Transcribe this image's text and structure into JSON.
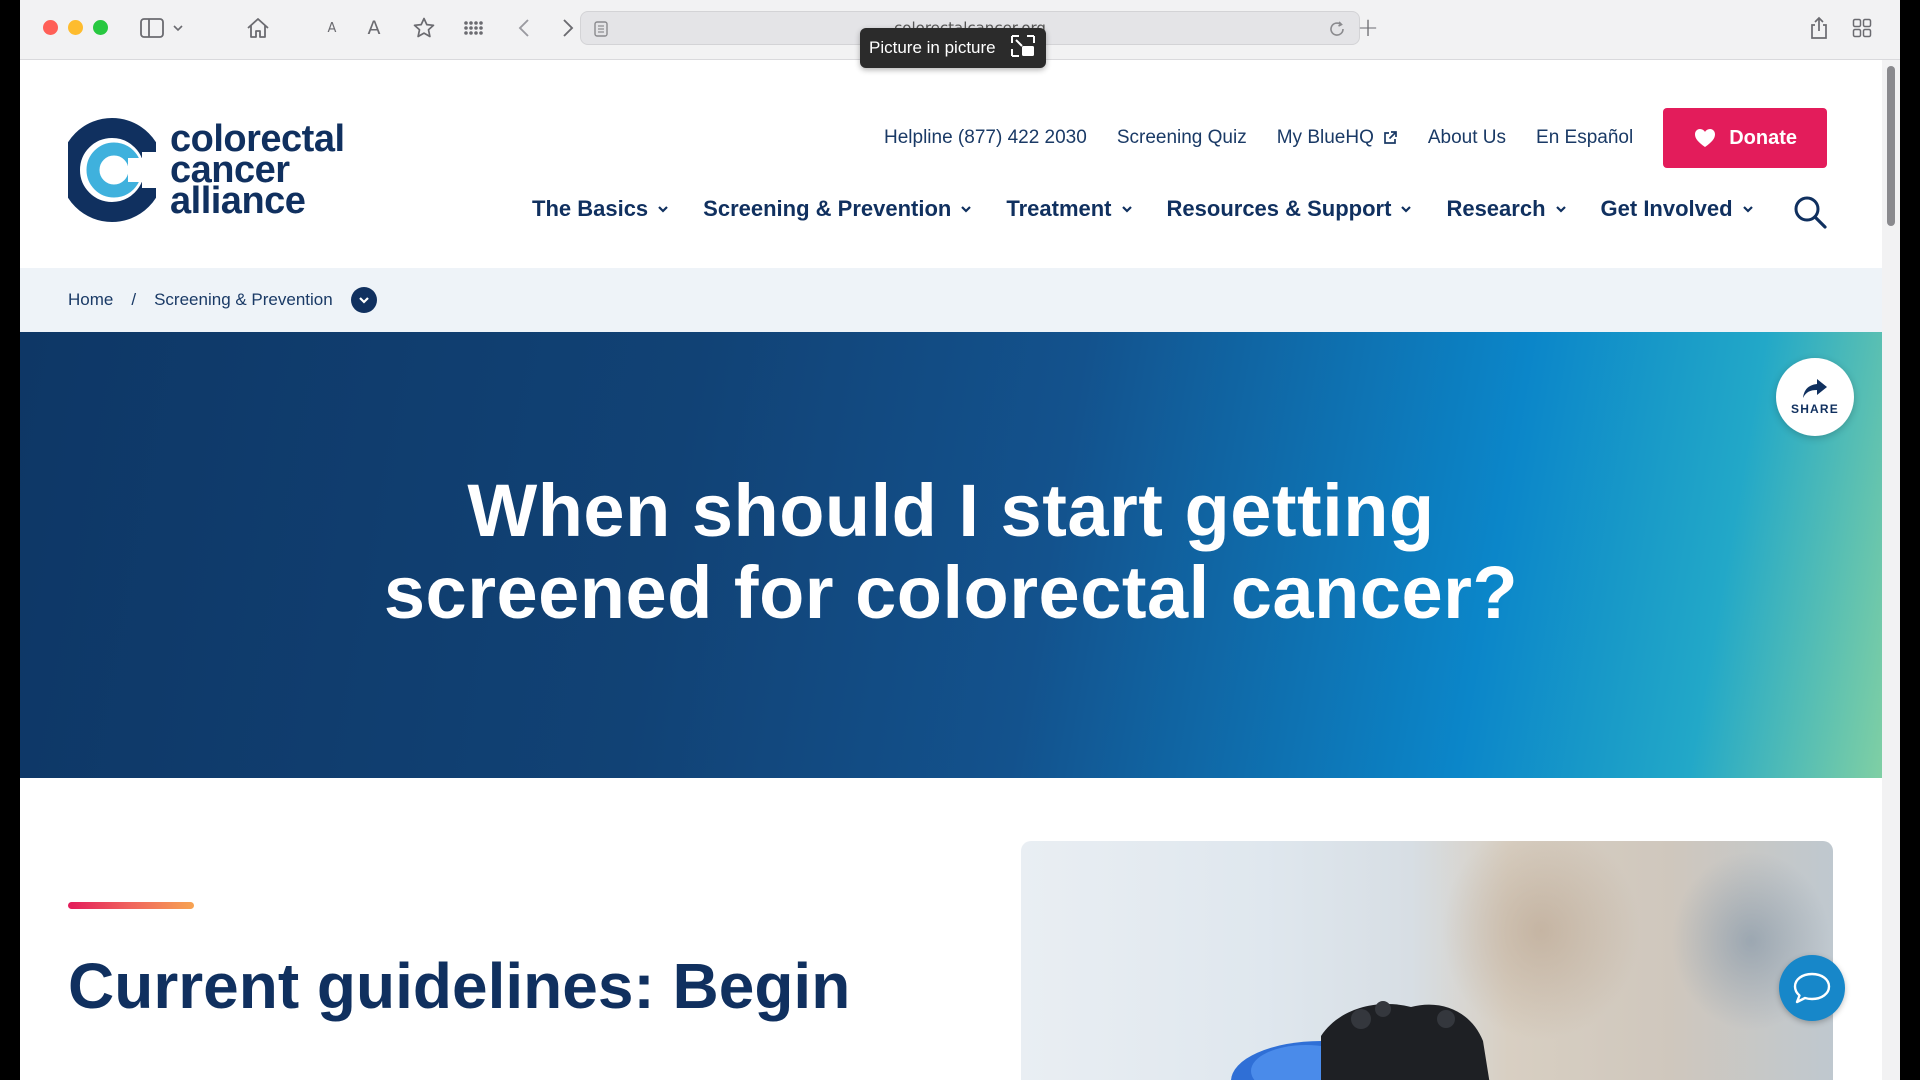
{
  "browser": {
    "url": "colorectalcancer.org",
    "pip_tooltip": "Picture in picture",
    "text_small": "A",
    "text_large": "A",
    "new_tab": "+"
  },
  "site": {
    "logo_lines": [
      "colorectal",
      "cancer",
      "alliance"
    ],
    "util_links": [
      "Helpline (877) 422 2030",
      "Screening Quiz",
      "My BlueHQ",
      "About Us",
      "En Español"
    ],
    "donate_label": "Donate",
    "main_nav": [
      "The Basics",
      "Screening & Prevention",
      "Treatment",
      "Resources & Support",
      "Research",
      "Get Involved"
    ]
  },
  "breadcrumb": {
    "items": [
      "Home",
      "Screening & Prevention"
    ],
    "separator": "/"
  },
  "hero": {
    "title_line1": "When should I start getting",
    "title_line2": "screened for colorectal cancer?",
    "share_label": "SHARE"
  },
  "content": {
    "heading": "Current guidelines: Begin"
  },
  "colors": {
    "brand_navy": "#10305f",
    "donate_pink": "#e31c5b",
    "chat_blue": "#1787c9"
  }
}
